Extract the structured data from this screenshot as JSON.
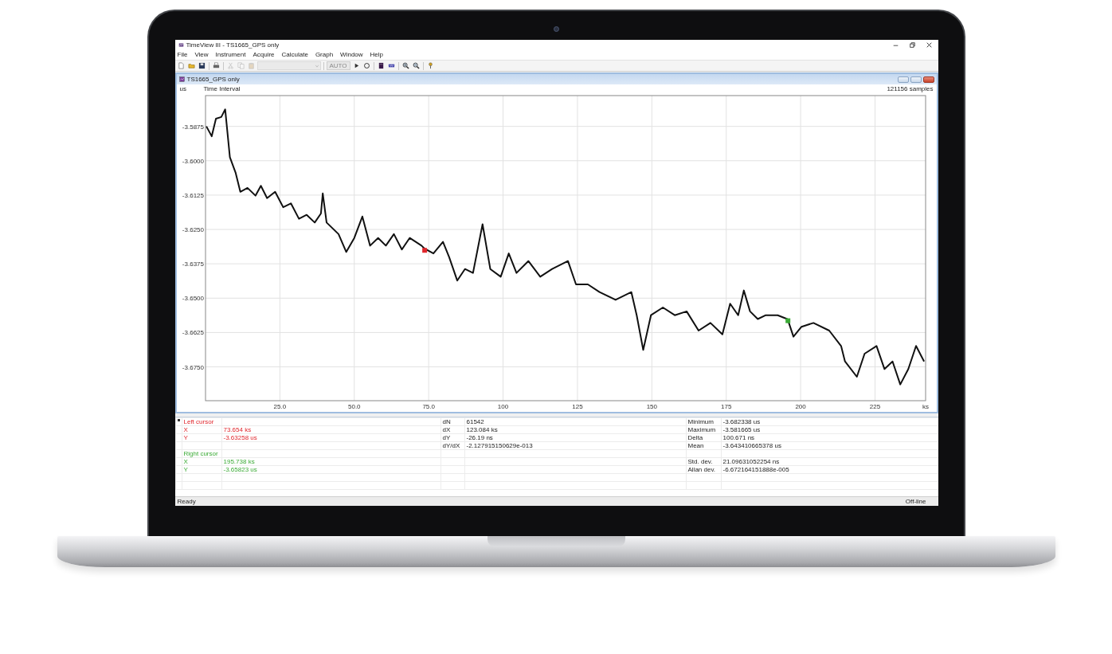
{
  "window": {
    "title": "TimeView III - TS1665_GPS only"
  },
  "menu": [
    "File",
    "View",
    "Instrument",
    "Acquire",
    "Calculate",
    "Graph",
    "Window",
    "Help"
  ],
  "toolbar": [
    {
      "kind": "icon",
      "disabled": false
    },
    {
      "kind": "icon",
      "disabled": false
    },
    {
      "kind": "icon",
      "disabled": false
    },
    {
      "kind": "separator"
    },
    {
      "kind": "icon",
      "disabled": false
    },
    {
      "kind": "separator"
    },
    {
      "kind": "icon",
      "disabled": true
    },
    {
      "kind": "icon",
      "disabled": true
    },
    {
      "kind": "icon",
      "disabled": true
    },
    {
      "kind": "combo",
      "disabled": true
    },
    {
      "kind": "separator"
    },
    {
      "kind": "text",
      "label": "AUTO",
      "disabled": true
    },
    {
      "kind": "icon",
      "disabled": false
    },
    {
      "kind": "icon",
      "disabled": false
    },
    {
      "kind": "separator"
    },
    {
      "kind": "icon",
      "disabled": false
    },
    {
      "kind": "icon",
      "disabled": false
    },
    {
      "kind": "separator"
    },
    {
      "kind": "icon",
      "disabled": false
    },
    {
      "kind": "icon",
      "disabled": false
    },
    {
      "kind": "separator"
    },
    {
      "kind": "icon",
      "disabled": false
    }
  ],
  "document": {
    "title": "TS1665_GPS only"
  },
  "graph": {
    "samples": "121156 samples",
    "chart_data": {
      "type": "line",
      "title": "Time Interval",
      "xlabel": "ks",
      "ylabel": "us",
      "grid": true,
      "xlim": [
        0,
        242
      ],
      "ylim": [
        -3.6873,
        -3.5763
      ],
      "xticks": [
        {
          "value": 25,
          "label": "25.0"
        },
        {
          "value": 50,
          "label": "50.0"
        },
        {
          "value": 75,
          "label": "75.0"
        },
        {
          "value": 100,
          "label": "100"
        },
        {
          "value": 125,
          "label": "125"
        },
        {
          "value": 150,
          "label": "150"
        },
        {
          "value": 175,
          "label": "175"
        },
        {
          "value": 200,
          "label": "200"
        },
        {
          "value": 225,
          "label": "225"
        }
      ],
      "yticks": [
        {
          "value": -3.5875,
          "label": "-3.5875"
        },
        {
          "value": -3.6,
          "label": "-3.6000"
        },
        {
          "value": -3.6125,
          "label": "-3.6125"
        },
        {
          "value": -3.625,
          "label": "-3.6250"
        },
        {
          "value": -3.6375,
          "label": "-3.6375"
        },
        {
          "value": -3.65,
          "label": "-3.6500"
        },
        {
          "value": -3.6625,
          "label": "-3.6625"
        },
        {
          "value": -3.675,
          "label": "-3.6750"
        }
      ],
      "x": [
        0.3,
        2.1,
        3.5,
        5.3,
        6.6,
        8.2,
        10.1,
        11.7,
        14.1,
        16.8,
        18.6,
        20.7,
        23.4,
        26.1,
        28.7,
        31.4,
        34.0,
        36.7,
        38.8,
        39.4,
        40.7,
        44.7,
        47.3,
        50.0,
        52.7,
        55.3,
        58.0,
        60.6,
        63.3,
        66.0,
        68.6,
        72.6,
        73.654,
        76.6,
        79.8,
        81.9,
        84.6,
        87.2,
        89.9,
        93.1,
        95.7,
        99.2,
        101.9,
        104.5,
        108.5,
        112.5,
        116.5,
        121.8,
        124.5,
        128.5,
        132.4,
        137.8,
        143.1,
        144.9,
        147.1,
        149.7,
        153.7,
        157.7,
        161.7,
        165.7,
        169.7,
        173.7,
        176.3,
        179.0,
        180.9,
        183.0,
        185.6,
        188.3,
        192.3,
        195.5,
        195.738,
        197.6,
        200.3,
        204.3,
        209.6,
        213.6,
        214.9,
        218.9,
        221.5,
        225.5,
        228.2,
        230.9,
        233.5,
        236.2,
        238.8,
        241.5
      ],
      "series": [
        {
          "color": "#111111",
          "values": [
            -3.5875,
            -3.5911,
            -3.5847,
            -3.5841,
            -3.5813,
            -3.5987,
            -3.6043,
            -3.6113,
            -3.6099,
            -3.6127,
            -3.6091,
            -3.6136,
            -3.6113,
            -3.6169,
            -3.6155,
            -3.6211,
            -3.6197,
            -3.6225,
            -3.6192,
            -3.6119,
            -3.6225,
            -3.6267,
            -3.6332,
            -3.6281,
            -3.6203,
            -3.6309,
            -3.6281,
            -3.6309,
            -3.6267,
            -3.6323,
            -3.6281,
            -3.6309,
            -3.632,
            -3.6337,
            -3.6295,
            -3.6351,
            -3.6436,
            -3.6394,
            -3.6408,
            -3.6231,
            -3.6394,
            -3.6422,
            -3.6337,
            -3.6408,
            -3.6365,
            -3.6422,
            -3.6394,
            -3.6365,
            -3.645,
            -3.645,
            -3.6478,
            -3.6506,
            -3.6478,
            -3.6562,
            -3.6688,
            -3.6562,
            -3.6534,
            -3.6562,
            -3.6548,
            -3.6618,
            -3.659,
            -3.6632,
            -3.652,
            -3.6562,
            -3.6472,
            -3.6548,
            -3.6576,
            -3.6562,
            -3.6562,
            -3.6576,
            -3.658,
            -3.664,
            -3.6604,
            -3.659,
            -3.6618,
            -3.6674,
            -3.673,
            -3.6786,
            -3.6702,
            -3.6674,
            -3.6758,
            -3.673,
            -3.6814,
            -3.6758,
            -3.6674,
            -3.673
          ]
        },
        {
          "name": "Left cursor",
          "color": "#e0262c",
          "marker": "square",
          "values": [
            null,
            null,
            null,
            null,
            null,
            null,
            null,
            null,
            null,
            null,
            null,
            null,
            null,
            null,
            null,
            null,
            null,
            null,
            null,
            null,
            null,
            null,
            null,
            null,
            null,
            null,
            null,
            null,
            null,
            null,
            null,
            null,
            -3.6326,
            null,
            null,
            null,
            null,
            null,
            null,
            null,
            null,
            null,
            null,
            null,
            null,
            null,
            null,
            null,
            null,
            null,
            null,
            null,
            null,
            null,
            null,
            null,
            null,
            null,
            null,
            null,
            null,
            null,
            null,
            null,
            null,
            null,
            null,
            null,
            null,
            null,
            null,
            null,
            null,
            null,
            null,
            null,
            null,
            null,
            null,
            null,
            null,
            null,
            null,
            null,
            null,
            null
          ]
        },
        {
          "name": "Right cursor",
          "color": "#3aaa35",
          "marker": "square",
          "values": [
            null,
            null,
            null,
            null,
            null,
            null,
            null,
            null,
            null,
            null,
            null,
            null,
            null,
            null,
            null,
            null,
            null,
            null,
            null,
            null,
            null,
            null,
            null,
            null,
            null,
            null,
            null,
            null,
            null,
            null,
            null,
            null,
            null,
            null,
            null,
            null,
            null,
            null,
            null,
            null,
            null,
            null,
            null,
            null,
            null,
            null,
            null,
            null,
            null,
            null,
            null,
            null,
            null,
            null,
            null,
            null,
            null,
            null,
            null,
            null,
            null,
            null,
            null,
            null,
            null,
            null,
            null,
            null,
            null,
            null,
            -3.6582,
            null,
            null,
            null,
            null,
            null,
            null,
            null,
            null,
            null,
            null,
            null,
            null,
            null,
            null,
            null
          ]
        }
      ]
    }
  },
  "cursors": [
    {
      "x_label": "X",
      "x_value": "73.654 ks",
      "y_label": "Y",
      "y_value": "-3.63258 us"
    },
    {
      "x_label": "X",
      "x_value": "195.738 ks",
      "y_label": "Y",
      "y_value": "-3.65823 us"
    }
  ],
  "differences": [
    {
      "label": "dN",
      "value": "61542"
    },
    {
      "label": "dX",
      "value": "123.084 ks"
    },
    {
      "label": "dY",
      "value": "-26.19 ns"
    },
    {
      "label": "dY/dX",
      "value": "-2.127915150629e-013"
    }
  ],
  "statistics": [
    [
      {
        "label": "Minimum",
        "value": "-3.682338 us"
      },
      {
        "label": "Maximum",
        "value": "-3.581665 us"
      },
      {
        "label": "Delta",
        "value": "100.671 ns"
      },
      {
        "label": "Mean",
        "value": "-3.643410665378 us"
      }
    ],
    [
      {
        "label": "Std. dev.",
        "value": "21.09631052254 ns"
      },
      {
        "label": "Allan dev.",
        "value": "-6.672164151888e-005"
      }
    ]
  ],
  "status_bar": {
    "left": "Ready",
    "right": "Off-line"
  }
}
